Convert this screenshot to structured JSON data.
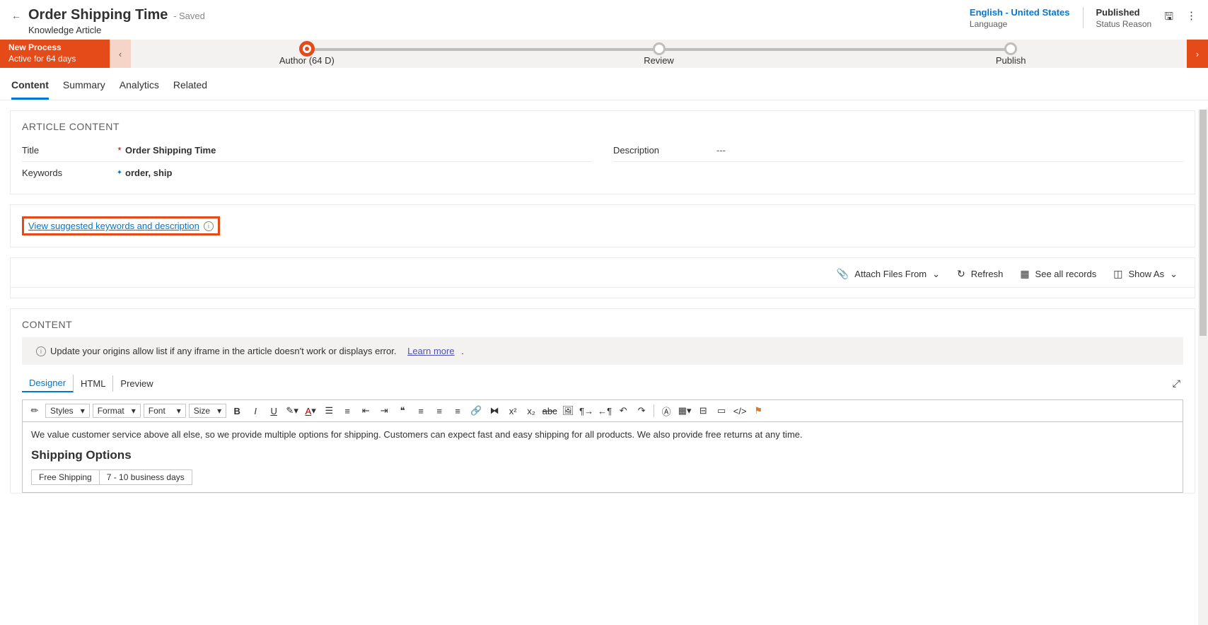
{
  "header": {
    "title": "Order Shipping Time",
    "saved_state": "- Saved",
    "subtitle": "Knowledge Article",
    "language_value": "English - United States",
    "language_label": "Language",
    "status_value": "Published",
    "status_label": "Status Reason"
  },
  "process": {
    "name": "New Process",
    "duration": "Active for 64 days",
    "stages": {
      "author": "Author  (64 D)",
      "review": "Review",
      "publish": "Publish"
    }
  },
  "tabs": {
    "content": "Content",
    "summary": "Summary",
    "analytics": "Analytics",
    "related": "Related"
  },
  "article": {
    "section_title": "ARTICLE CONTENT",
    "title_label": "Title",
    "title_value": "Order Shipping Time",
    "keywords_label": "Keywords",
    "keywords_value": "order, ship",
    "description_label": "Description",
    "description_value": "---"
  },
  "suggest": {
    "link": "View suggested keywords and description"
  },
  "toolbar": {
    "attach": "Attach Files From",
    "refresh": "Refresh",
    "see_all": "See all records",
    "show_as": "Show As"
  },
  "content_section": {
    "title": "CONTENT",
    "banner_text": "Update your origins allow list if any iframe in the article doesn't work or displays error.",
    "learn_more": "Learn more",
    "tabs": {
      "designer": "Designer",
      "html": "HTML",
      "preview": "Preview"
    },
    "styles_dd": "Styles",
    "format_dd": "Format",
    "font_dd": "Font",
    "size_dd": "Size",
    "body_intro": "We value customer service above all else, so we provide multiple options for shipping. Customers can expect fast and easy shipping for all products. We also provide free returns at any time.",
    "body_heading": "Shipping Options",
    "table": {
      "r1c1": "Free Shipping",
      "r1c2": "7 - 10 business days"
    }
  }
}
